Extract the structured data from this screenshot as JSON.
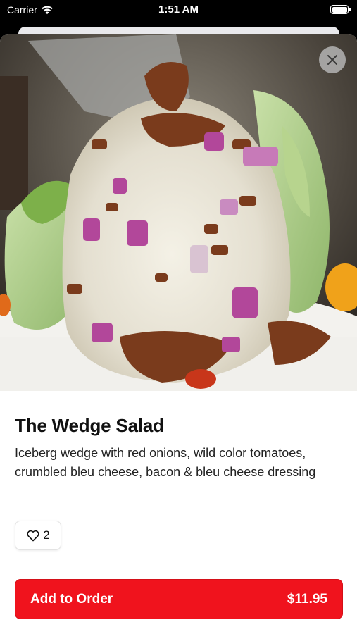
{
  "status_bar": {
    "carrier": "Carrier",
    "time": "1:51 AM",
    "icons": [
      "wifi-icon",
      "battery-icon"
    ]
  },
  "item": {
    "title": "The Wedge Salad",
    "description": "Iceberg wedge with red onions, wild color tomatoes, crumbled bleu cheese, bacon & bleu cheese dressing",
    "image_alt": "wedge-salad-photo"
  },
  "like": {
    "icon": "heart-outline-icon",
    "count": "2"
  },
  "order_button": {
    "label": "Add to Order",
    "price": "$11.95",
    "color": "#f0131d"
  },
  "close": {
    "icon": "close-icon"
  }
}
